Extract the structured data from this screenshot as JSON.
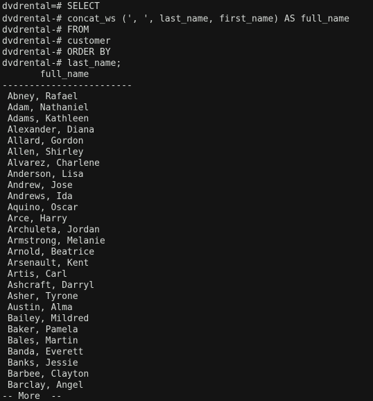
{
  "terminal": {
    "background_color": "#141414",
    "foreground_color": "#d6dad6",
    "prompt_primary": "dvdrental=#",
    "prompt_continuation": "dvdrental-#",
    "query_lines": [
      "dvdrental=# SELECT",
      "dvdrental-# concat_ws (', ', last_name, first_name) AS full_name",
      "dvdrental-# FROM",
      "dvdrental-# customer",
      "dvdrental-# ORDER BY",
      "dvdrental-# last_name;"
    ],
    "result": {
      "column_header": "       full_name",
      "separator": "------------------------",
      "rows": [
        " Abney, Rafael",
        " Adam, Nathaniel",
        " Adams, Kathleen",
        " Alexander, Diana",
        " Allard, Gordon",
        " Allen, Shirley",
        " Alvarez, Charlene",
        " Anderson, Lisa",
        " Andrew, Jose",
        " Andrews, Ida",
        " Aquino, Oscar",
        " Arce, Harry",
        " Archuleta, Jordan",
        " Armstrong, Melanie",
        " Arnold, Beatrice",
        " Arsenault, Kent",
        " Artis, Carl",
        " Ashcraft, Darryl",
        " Asher, Tyrone",
        " Austin, Alma",
        " Bailey, Mildred",
        " Baker, Pamela",
        " Bales, Martin",
        " Banda, Everett",
        " Banks, Jessie",
        " Barbee, Clayton",
        " Barclay, Angel"
      ]
    },
    "pager_prompt": "-- More  --"
  }
}
